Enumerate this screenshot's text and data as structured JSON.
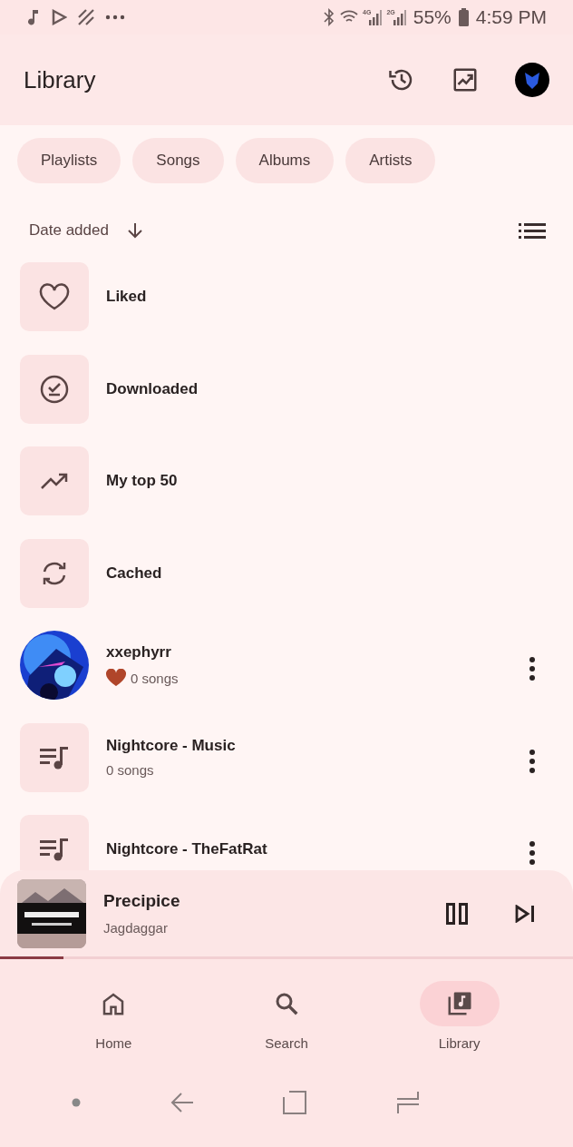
{
  "status_bar": {
    "signals": [
      {
        "label": "4G"
      },
      {
        "label": "2G"
      }
    ],
    "battery": "55%",
    "time": "4:59 PM"
  },
  "header": {
    "title": "Library"
  },
  "chips": [
    {
      "label": "Playlists",
      "selected": false
    },
    {
      "label": "Songs",
      "selected": false
    },
    {
      "label": "Albums",
      "selected": false
    },
    {
      "label": "Artists",
      "selected": false
    }
  ],
  "sort": {
    "label": "Date added"
  },
  "items": [
    {
      "kind": "liked",
      "name": "Liked"
    },
    {
      "kind": "downloaded",
      "name": "Downloaded"
    },
    {
      "kind": "top",
      "name": "My top 50"
    },
    {
      "kind": "cached",
      "name": "Cached"
    },
    {
      "kind": "profile",
      "name": "xxephyrr",
      "liked": true,
      "subtitle": "0 songs"
    },
    {
      "kind": "playlist",
      "name": "Nightcore - Music",
      "subtitle": "0 songs"
    },
    {
      "kind": "playlist",
      "name": "Nightcore - TheFatRat"
    }
  ],
  "now_playing": {
    "title": "Precipice",
    "artist": "Jagdaggar",
    "level": 0.11
  },
  "nav": [
    {
      "kind": "home",
      "label": "Home",
      "selected": false
    },
    {
      "kind": "search",
      "label": "Search",
      "selected": false
    },
    {
      "kind": "library",
      "label": "Library",
      "selected": true
    }
  ]
}
